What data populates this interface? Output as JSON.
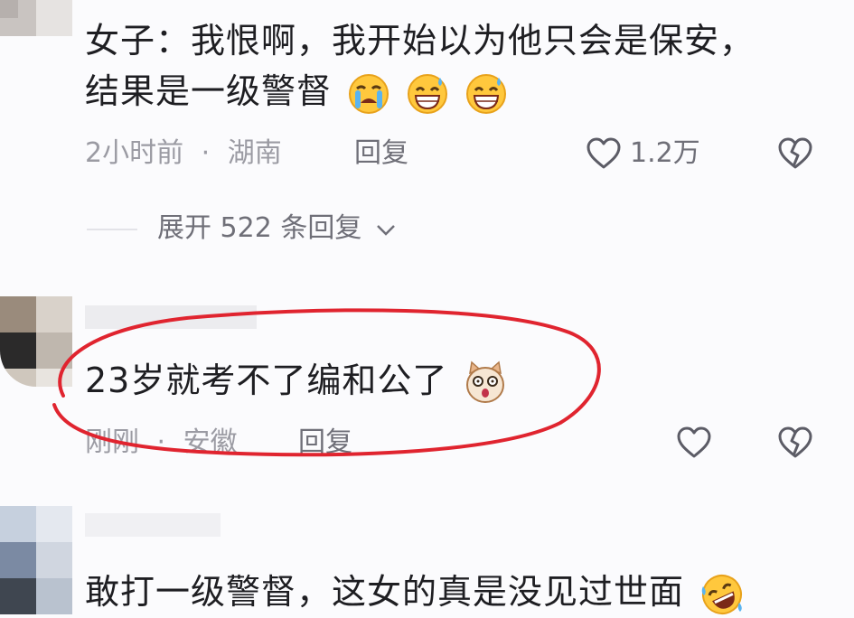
{
  "comments": [
    {
      "text_line1": "女子：我恨啊，我开始以为他只会是保安，",
      "text_line2": "结果是一级警督",
      "emojis": [
        "crying-emoji",
        "grin-sweat-emoji",
        "grin-sweat-emoji"
      ],
      "time": "2小时前",
      "separator": "·",
      "location": "湖南",
      "reply_label": "回复",
      "like_count": "1.2万",
      "expand_label": "展开 522 条回复"
    },
    {
      "text": "23岁就考不了编和公了",
      "emojis": [
        "shocked-cat-emoji"
      ],
      "time": "刚刚",
      "separator": "·",
      "location": "安徽",
      "reply_label": "回复",
      "highlight_color": "#e0242f"
    },
    {
      "text": "敢打一级警督，这女的真是没见过世面",
      "emojis": [
        "rofl-emoji"
      ]
    }
  ],
  "colors": {
    "background": "#fbfbfd",
    "text": "#1e1e22",
    "meta": "#9b9ba3",
    "highlight": "#e0242f"
  },
  "icons": [
    "heart-outline-icon",
    "broken-heart-icon",
    "chevron-down-icon"
  ]
}
